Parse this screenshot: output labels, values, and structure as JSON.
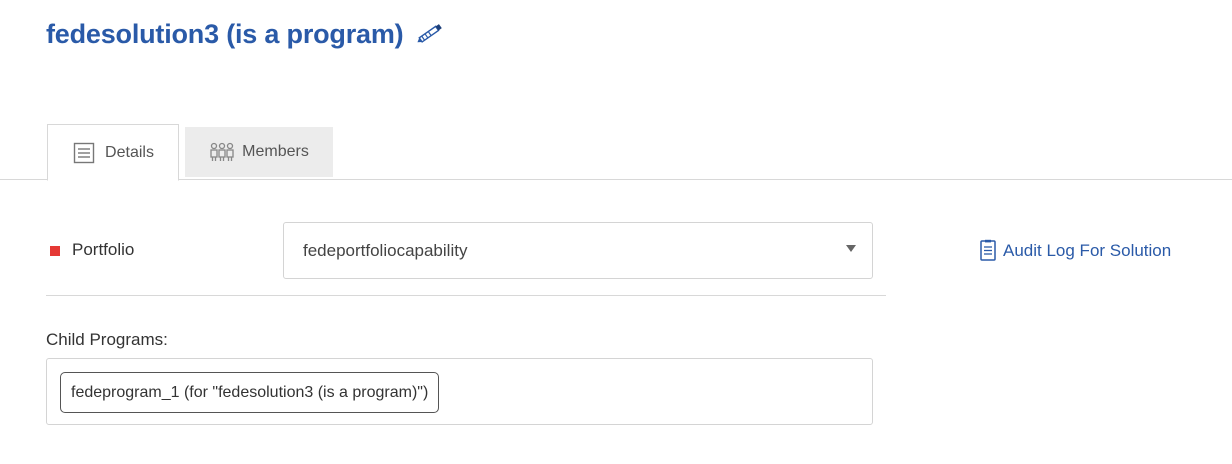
{
  "header": {
    "title": "fedesolution3 (is a program)",
    "edit_icon": "pencil-icon",
    "title_color": "#2a5aa8"
  },
  "tabs": [
    {
      "label": "Details",
      "icon": "details-icon",
      "active": true
    },
    {
      "label": "Members",
      "icon": "members-icon",
      "active": false
    }
  ],
  "form": {
    "portfolio": {
      "label": "Portfolio",
      "required": true,
      "required_color": "#e53935",
      "selected_value": "fedeportfoliocapability"
    },
    "child_programs": {
      "label": "Child Programs:",
      "items": [
        "fedeprogram_1 (for \"fedesolution3 (is a program)\")"
      ]
    }
  },
  "audit_link": {
    "label": "Audit Log For Solution",
    "icon": "document-icon",
    "color": "#2a5aa8"
  }
}
